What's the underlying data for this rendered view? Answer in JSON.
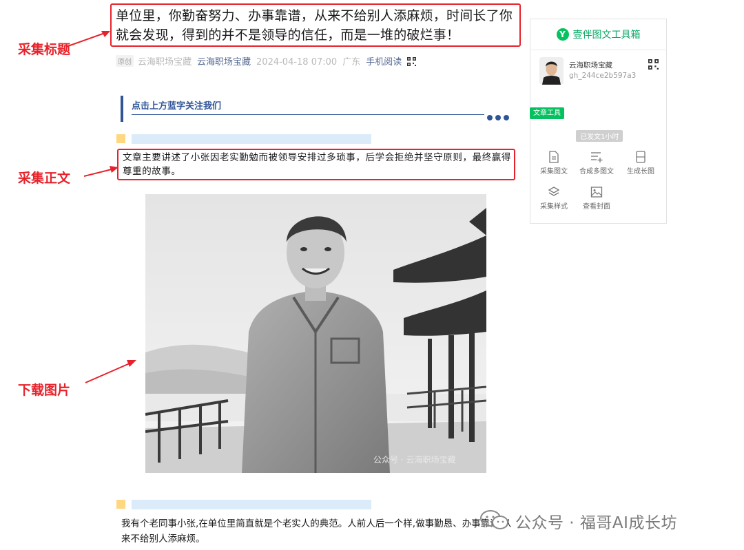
{
  "article": {
    "title": "单位里，你勤奋努力、办事靠谱，从来不给别人添麻烦，时间长了你就会发现，得到的并不是领导的信任，而是一堆的破烂事！",
    "meta": {
      "tag": "原创",
      "author": "云海职场宝藏",
      "account": "云海职场宝藏",
      "datetime": "2024-04-18 07:00",
      "location": "广东",
      "mobile_read": "手机阅读"
    },
    "follow_banner": "点击上方蓝字关注我们",
    "summary": "文章主要讲述了小张因老实勤勉而被领导安排过多琐事，后学会拒绝并坚守原则，最终赢得尊重的故事。",
    "image_watermark": "公众号 · 云海职场宝藏",
    "body_paragraph": "我有个老同事小张,在单位里简直就是个老实人的典范。人前人后一个样,做事勤恳、办事靠谱,从来不给别人添麻烦。"
  },
  "annotations": {
    "title": "采集标题",
    "body": "采集正文",
    "image": "下载图片",
    "color": "#e8222b"
  },
  "side_panel": {
    "brand": "壹伴图文工具箱",
    "logo_letter": "Y",
    "account_name": "云海职场宝藏",
    "account_id": "gh_244ce2b597a3",
    "tool_tag": "文章工具",
    "time_badge": "已发文1小时",
    "tools": [
      {
        "label": "采集图文",
        "icon": "doc-icon"
      },
      {
        "label": "合成多图文",
        "icon": "list-add-icon"
      },
      {
        "label": "生成长图",
        "icon": "long-image-icon"
      },
      {
        "label": "采集样式",
        "icon": "layers-icon"
      },
      {
        "label": "查看封面",
        "icon": "image-icon"
      }
    ],
    "accent": "#07c160"
  },
  "footer_watermark": "公众号 · 福哥AI成长坊"
}
